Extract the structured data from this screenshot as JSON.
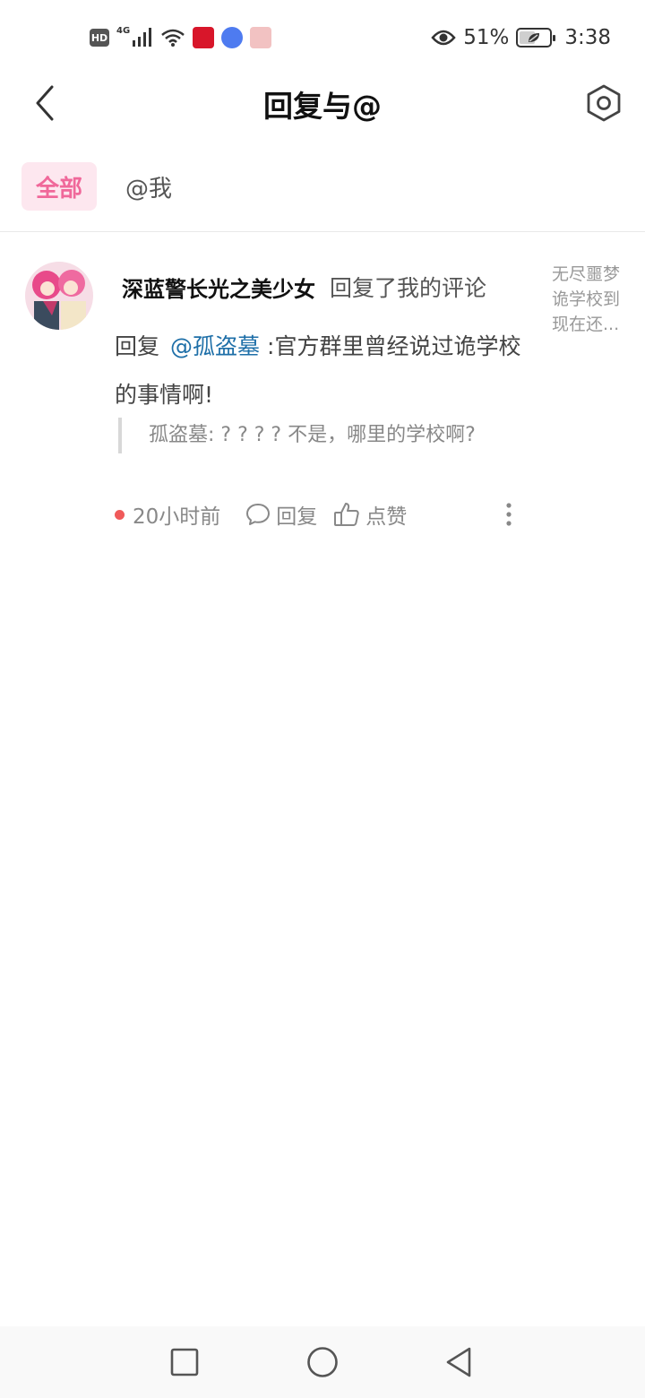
{
  "status_bar": {
    "hd": "HD",
    "signal": "4G",
    "battery_percent": "51%",
    "battery_level": 0.51,
    "time": "3:38"
  },
  "header": {
    "title": "回复与@",
    "back_icon": "chevron-left-icon",
    "settings_icon": "hexagon-settings-icon"
  },
  "tabs": [
    {
      "label": "全部",
      "active": true
    },
    {
      "label": "@我",
      "active": false
    }
  ],
  "message": {
    "user_name": "深蓝警长光之美少女",
    "action": "回复了我的评论",
    "reply_prefix": "回复",
    "mention": "@孤盗墓",
    "reply_text": ":官方群里曾经说过诡学校的事情啊!",
    "quote": "孤盗墓: ? ? ? ?  不是，哪里的学校啊?",
    "side_preview": "无尽噩梦诡学校到现在还...",
    "time": "20小时前",
    "reply_label": "回复",
    "like_label": "点赞"
  },
  "colors": {
    "accent": "#f0689a",
    "accent_bg": "#fde7ef",
    "mention": "#1e6fa8",
    "unread_dot": "#f05a5a"
  }
}
